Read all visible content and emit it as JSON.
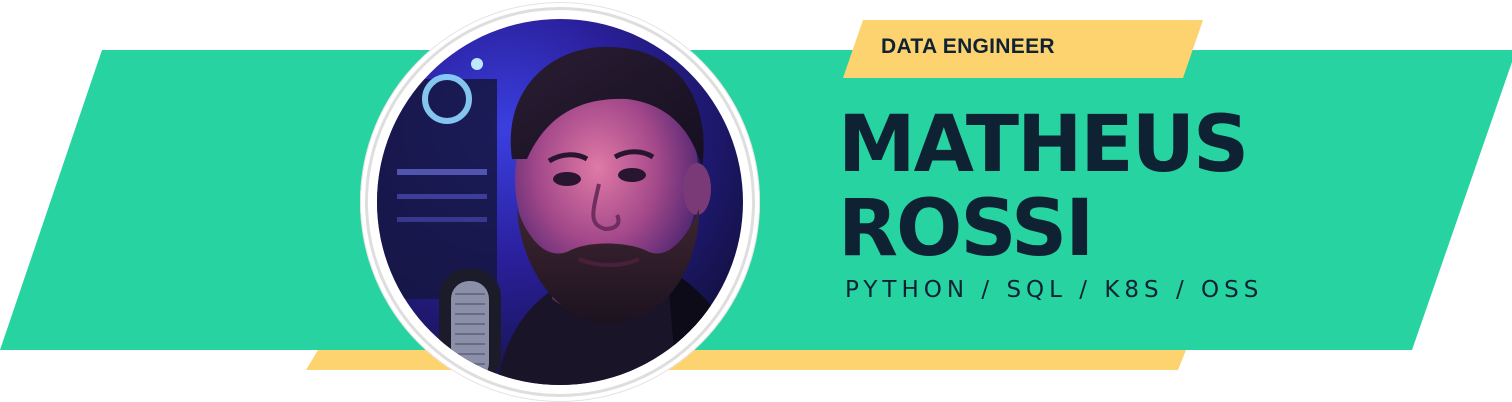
{
  "banner": {
    "role": "DATA ENGINEER",
    "name_line_1": "MATHEUS",
    "name_line_2": "ROSSI",
    "skills": "PYTHON / SQL / K8S / OSS"
  },
  "colors": {
    "band_green": "#27d3a0",
    "accent_yellow": "#fdd36f",
    "text_dark": "#0f2233",
    "photo_glow_blue": "#3d2dd1",
    "photo_glow_magenta": "#b13ad6"
  }
}
